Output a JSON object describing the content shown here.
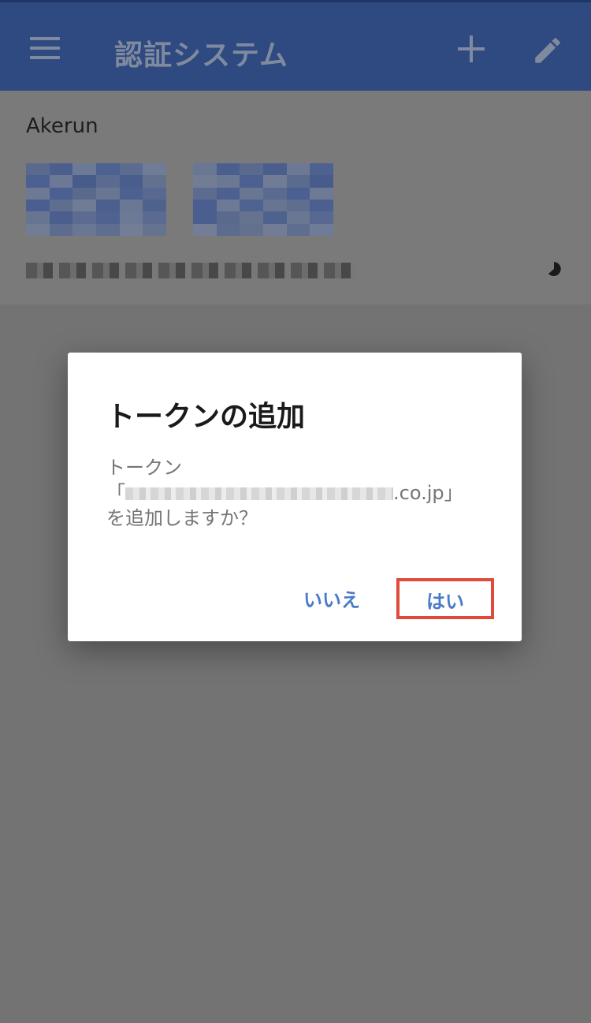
{
  "app_bar": {
    "title": "認証システム",
    "icons": [
      "menu-icon",
      "add-icon",
      "edit-icon"
    ]
  },
  "account": {
    "issuer": "Akerun"
  },
  "dialog": {
    "title": "トークンの追加",
    "message_line1": "トークン",
    "message_prefix": "「",
    "message_suffix": ".co.jp」",
    "message_line3": "を追加しますか？",
    "no_label": "いいえ",
    "yes_label": "はい"
  },
  "colors": {
    "app_bar": "#2f4a80",
    "button_text": "#4a7bc8",
    "highlight": "#e04a3a",
    "overlay": "#737373"
  }
}
